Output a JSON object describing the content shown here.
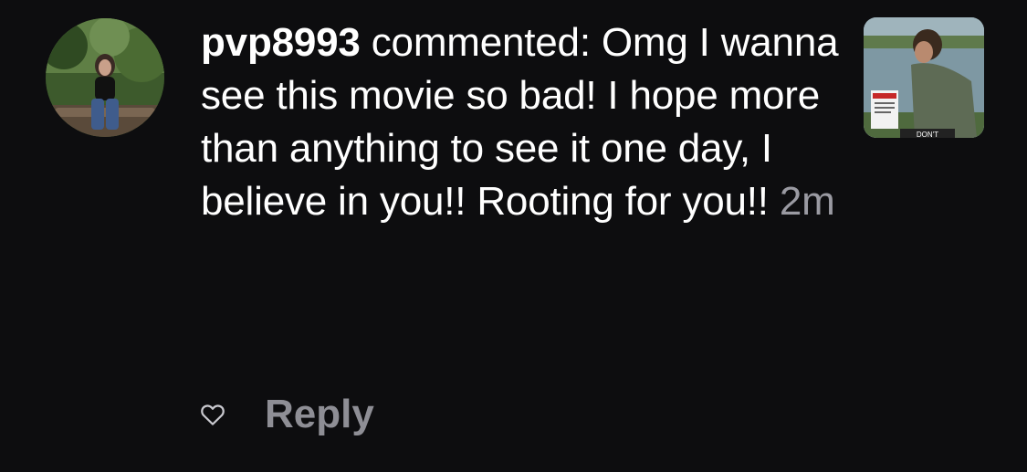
{
  "comment": {
    "username": "pvp8993",
    "verb": "commented:",
    "text": "Omg I wanna see this movie so bad! I hope more than anything to see it one day, I believe in you!! Rooting for you!!",
    "timestamp": "2m"
  },
  "thumbnail": {
    "sign_text": "DON'T"
  },
  "actions": {
    "like_icon": "heart-outline-icon",
    "reply_label": "Reply"
  },
  "colors": {
    "background": "#0d0d0f",
    "text": "#ffffff",
    "muted": "#9a9aa2",
    "reply": "#8e8e95"
  }
}
